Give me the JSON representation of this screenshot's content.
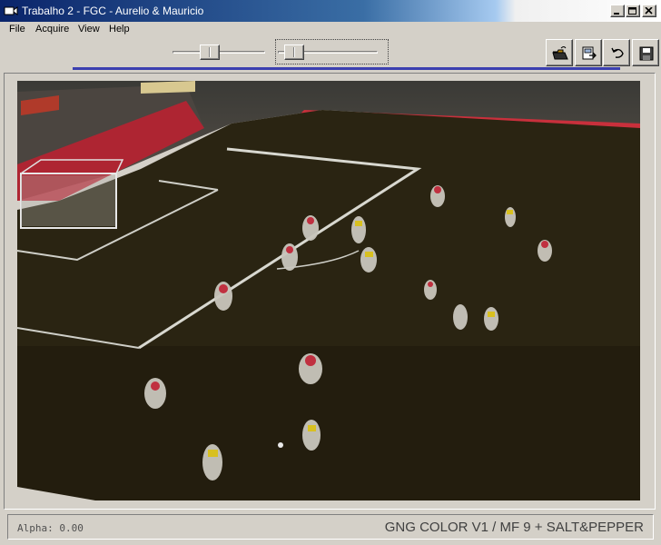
{
  "window": {
    "title": "Trabalho 2 - FGC - Aurelio & Mauricio",
    "icon": "video-camera-icon",
    "controls": [
      "minimize-icon",
      "maximize-icon",
      "close-icon"
    ]
  },
  "menu": {
    "items": [
      {
        "label": "File"
      },
      {
        "label": "Acquire"
      },
      {
        "label": "View"
      },
      {
        "label": "Help"
      }
    ]
  },
  "toolbar": {
    "slider_alpha_value": 0.38,
    "slider_second_value": 0.08,
    "buttons": [
      {
        "icon": "open-folder-icon"
      },
      {
        "icon": "export-frames-icon"
      },
      {
        "icon": "undo-icon"
      },
      {
        "icon": "save-disk-icon"
      }
    ]
  },
  "status": {
    "alpha": "Alpha: 0.00",
    "mode": "GNG COLOR V1 / MF 9 + SALT&PEPPER"
  },
  "colors": {
    "title_start": "#0a246a",
    "title_end": "#a6caf0",
    "field": "#2a2412",
    "progress": "#3b3fb0"
  }
}
